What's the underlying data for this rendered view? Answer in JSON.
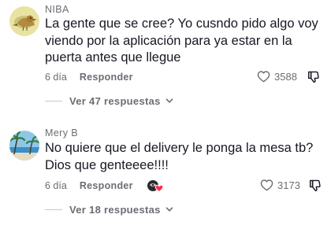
{
  "comments": [
    {
      "username": "NIBA",
      "text": "La gente que se cree? Yo cusndo pido algo voy viendo por la aplicación para ya estar en la puerta antes que llegue",
      "time": "6 día",
      "reply_label": "Responder",
      "likes": "3588",
      "view_replies": "Ver 47 respuestas",
      "avatar_icon": "bird-avatar"
    },
    {
      "username": "Mery B",
      "text": "No quiere que el delivery le ponga la mesa tb? Dios que genteeee!!!!",
      "time": "6 día",
      "reply_label": "Responder",
      "likes": "3173",
      "view_replies": "Ver 18 respuestas",
      "avatar_icon": "beach-avatar",
      "creator_badge_icon": "creator-liked-icon"
    }
  ],
  "colors": {
    "text": "#161823",
    "muted": "#6b6d73",
    "accent": "#fe2c55"
  }
}
